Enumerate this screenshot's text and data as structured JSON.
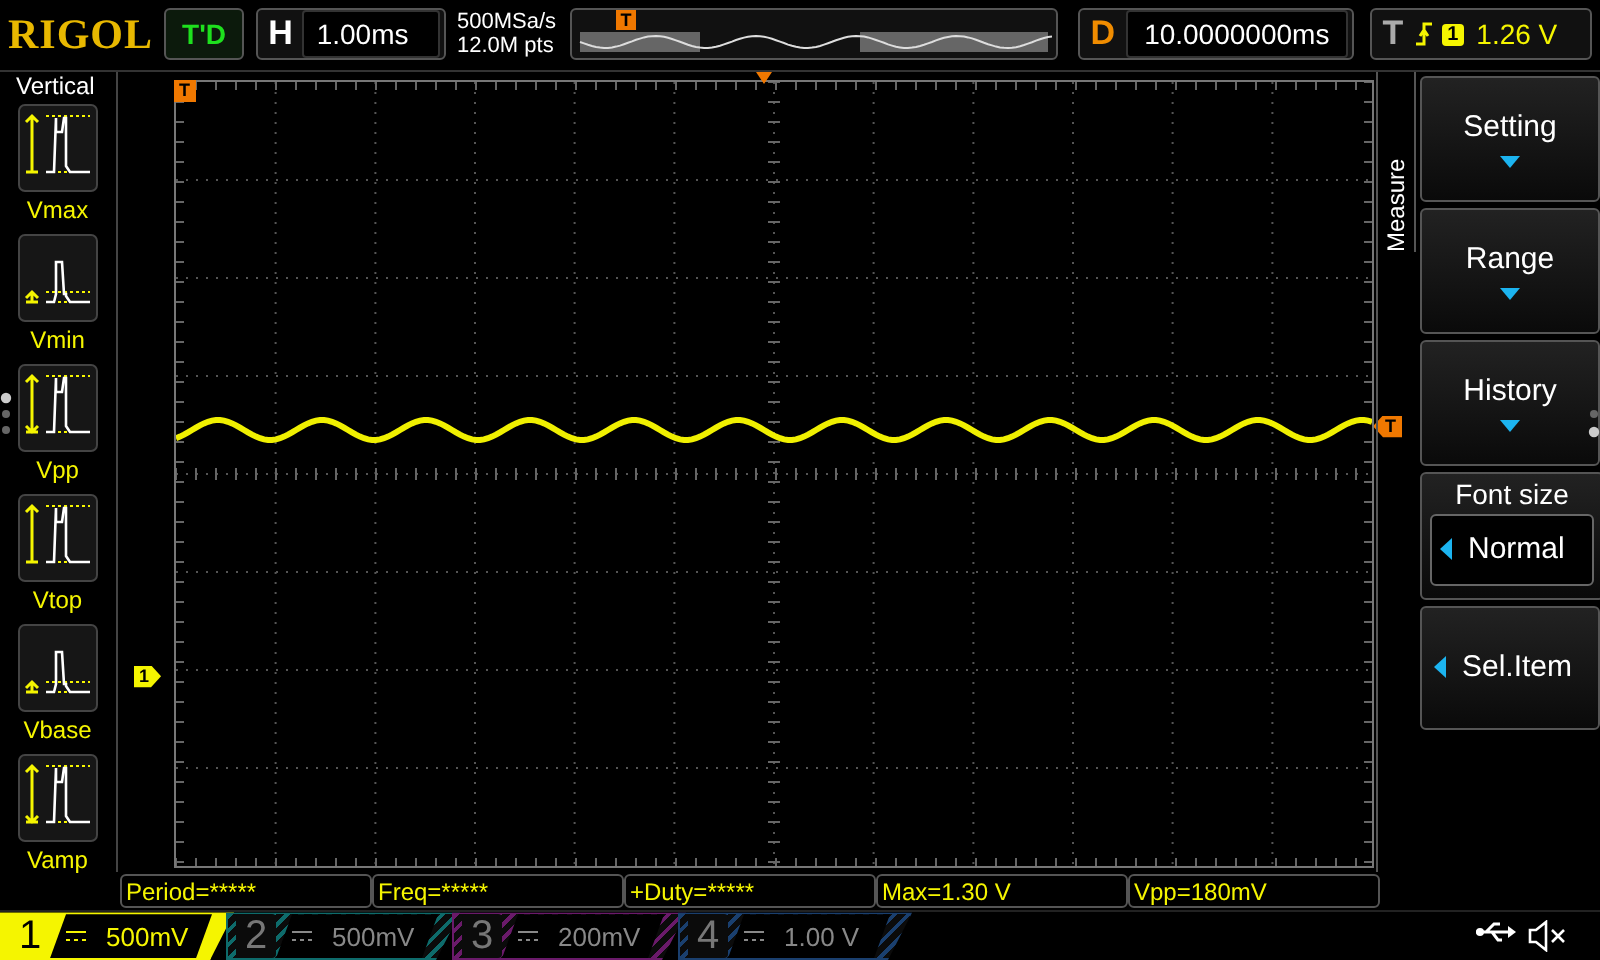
{
  "brand": "RIGOL",
  "trigger_status": "T'D",
  "timebase": {
    "label": "H",
    "value": "1.00ms"
  },
  "sample_rate": "500MSa/s",
  "memory_depth": "12.0M pts",
  "memory_marker": "T",
  "delay": {
    "label": "D",
    "value": "10.0000000ms"
  },
  "trigger": {
    "label": "T",
    "channel": "1",
    "level": "1.26 V"
  },
  "left_menu": {
    "title": "Vertical",
    "items": [
      {
        "label": "Vmax",
        "kind": "vmax"
      },
      {
        "label": "Vmin",
        "kind": "vmin"
      },
      {
        "label": "Vpp",
        "kind": "vpp"
      },
      {
        "label": "Vtop",
        "kind": "vtop"
      },
      {
        "label": "Vbase",
        "kind": "vbase"
      },
      {
        "label": "Vamp",
        "kind": "vamp"
      }
    ]
  },
  "screen": {
    "trigger_position_marker": "T",
    "trigger_level_marker": "T",
    "channel_marker": "1"
  },
  "right_menu": {
    "title": "Measure",
    "items": [
      {
        "label": "Setting",
        "kind": "submenu"
      },
      {
        "label": "Range",
        "kind": "submenu"
      },
      {
        "label": "History",
        "kind": "submenu"
      },
      {
        "label": "Font size",
        "kind": "value",
        "value": "Normal"
      },
      {
        "label": "Sel.Item",
        "kind": "select"
      }
    ]
  },
  "measurements": [
    "Period=*****",
    "Freq=*****",
    "+Duty=*****",
    "Max=1.30 V",
    "Vpp=180mV"
  ],
  "channels": [
    {
      "number": "1",
      "scale": "500mV",
      "on": true,
      "color": "#f5f500"
    },
    {
      "number": "2",
      "scale": "500mV",
      "on": false,
      "color": "#0e6b6b"
    },
    {
      "number": "3",
      "scale": "200mV",
      "on": false,
      "color": "#6a1a6a"
    },
    {
      "number": "4",
      "scale": "1.00 V",
      "on": false,
      "color": "#1a3f6e"
    }
  ]
}
